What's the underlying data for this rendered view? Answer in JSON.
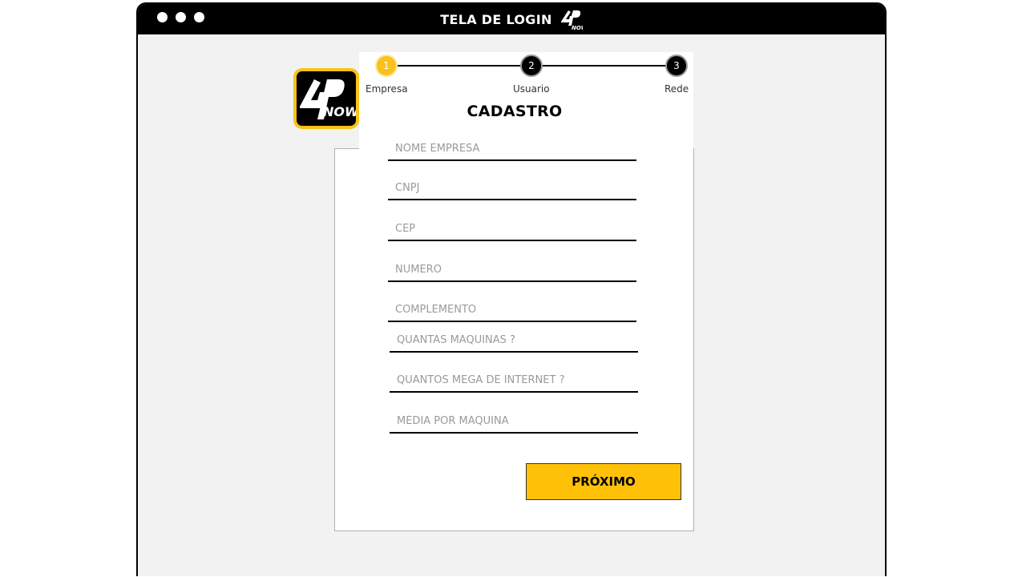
{
  "window": {
    "title": "TELA DE LOGIN",
    "logo_mark": "4PNOW"
  },
  "stepper": {
    "steps": [
      {
        "number": "1",
        "label": "Empresa",
        "state": "active"
      },
      {
        "number": "2",
        "label": "Usuario",
        "state": "inactive"
      },
      {
        "number": "3",
        "label": "Rede",
        "state": "inactive"
      }
    ]
  },
  "brand": {
    "logo_mark": "4PNOW"
  },
  "form": {
    "title": "CADASTRO",
    "fields": [
      {
        "placeholder": "NOME EMPRESA",
        "value": ""
      },
      {
        "placeholder": "CNPJ",
        "value": ""
      },
      {
        "placeholder": "CEP",
        "value": ""
      },
      {
        "placeholder": "NÚMERO",
        "value": ""
      },
      {
        "placeholder": "COMPLEMENTO",
        "value": ""
      },
      {
        "placeholder": "QUANTAS MÁQUINAS ?",
        "value": ""
      },
      {
        "placeholder": "QUANTOS MEGA DE INTERNET ?",
        "value": ""
      },
      {
        "placeholder": "MÉDIA POR MÁQUINA",
        "value": ""
      }
    ],
    "next_label": "PRÓXIMO"
  },
  "colors": {
    "accent": "#fec108",
    "step_active": "#f9c21a",
    "titlebar": "#000000",
    "window_bg": "#f2f2f2"
  },
  "icons": [
    "window-control-dot",
    "brand-logo-icon"
  ]
}
